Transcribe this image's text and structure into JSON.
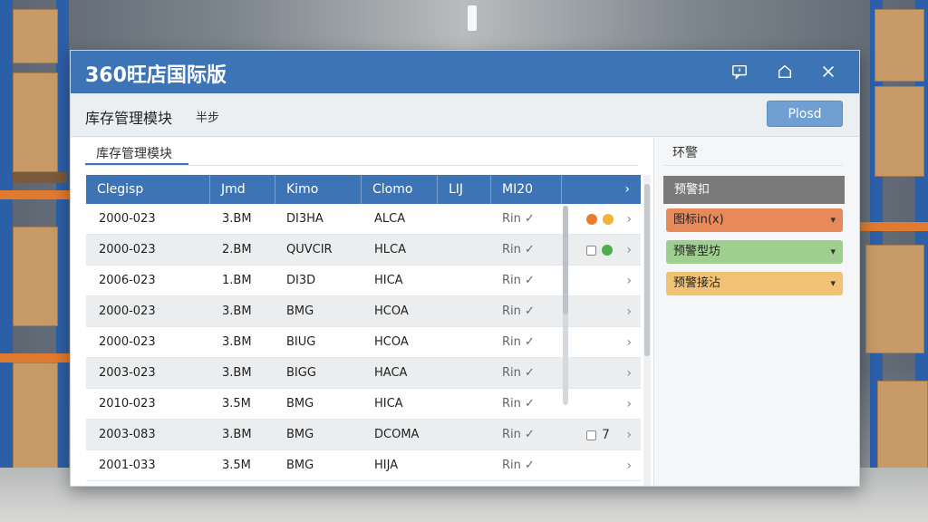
{
  "window": {
    "app_title": "360旺店国际版",
    "titlebar_icons": [
      "message-icon",
      "home-icon",
      "close-icon"
    ]
  },
  "subheader": {
    "module_title": "库存管理模块",
    "sub_label": "半步",
    "primary_button": "Plosd"
  },
  "tabs": [
    {
      "label": "库存管理模块",
      "active": true
    }
  ],
  "table": {
    "columns": [
      "Clegisp",
      "Jmd",
      "Kimo",
      "Clomo",
      "LIJ",
      "MI20"
    ],
    "rows": [
      {
        "c1": "2000-023",
        "c2": "3.BM",
        "c3": "DI3HA",
        "c4": "ALCA",
        "c5": "",
        "c6": "Rin ✓",
        "extra": "dots-orange"
      },
      {
        "c1": "2000-023",
        "c2": "2.BM",
        "c3": "QUVCIR",
        "c4": "HLCA",
        "c5": "",
        "c6": "Rin ✓",
        "extra": "check-green"
      },
      {
        "c1": "2006-023",
        "c2": "1.BM",
        "c3": "DI3D",
        "c4": "HICA",
        "c5": "",
        "c6": "Rin ✓",
        "extra": ""
      },
      {
        "c1": "2000-023",
        "c2": "3.BM",
        "c3": "BMG",
        "c4": "HCOA",
        "c5": "",
        "c6": "Rin ✓",
        "extra": ""
      },
      {
        "c1": "2000-023",
        "c2": "3.BM",
        "c3": "BIUG",
        "c4": "HCOA",
        "c5": "",
        "c6": "Rin ✓",
        "extra": ""
      },
      {
        "c1": "2003-023",
        "c2": "3.BM",
        "c3": "BIGG",
        "c4": "HACA",
        "c5": "",
        "c6": "Rin ✓",
        "extra": ""
      },
      {
        "c1": "2010-023",
        "c2": "3.5M",
        "c3": "BMG",
        "c4": "HICA",
        "c5": "",
        "c6": "Rin ✓",
        "extra": ""
      },
      {
        "c1": "2003-083",
        "c2": "3.BM",
        "c3": "BMG",
        "c4": "DCOMA",
        "c5": "",
        "c6": "Rin ✓",
        "extra": "check-7"
      },
      {
        "c1": "2001-033",
        "c2": "3.5M",
        "c3": "BMG",
        "c4": "HIJA",
        "c5": "",
        "c6": "Rin ✓",
        "extra": ""
      }
    ],
    "row_extra_text": "7"
  },
  "panel": {
    "title": "环警",
    "header": "预警扣",
    "items": [
      {
        "label": "图标in(x)",
        "color": "#e8895a"
      },
      {
        "label": "预警型坊",
        "color": "#9fcf8e"
      },
      {
        "label": "预警接沾",
        "color": "#efc274"
      }
    ]
  },
  "colors": {
    "titlebar": "#3d74b5",
    "table_header": "#3d74b5",
    "primary_button": "#6f9fd3",
    "dot_orange": "#e87c2c",
    "dot_yellow": "#f0b43a",
    "dot_green": "#4cae4c"
  }
}
